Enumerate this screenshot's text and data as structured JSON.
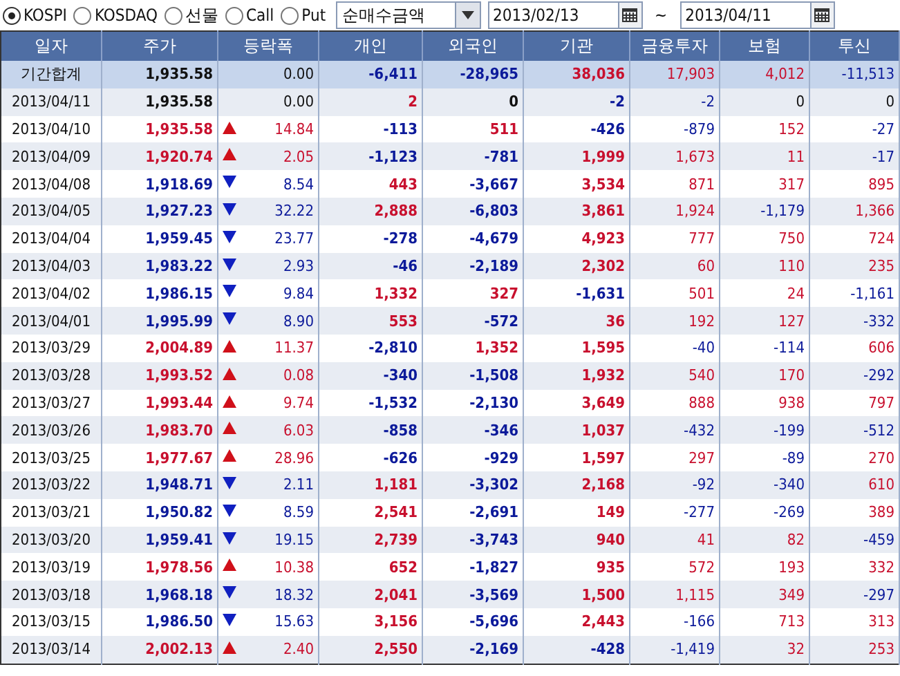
{
  "market_options": [
    {
      "label": "KOSPI",
      "selected": true
    },
    {
      "label": "KOSDAQ",
      "selected": false
    },
    {
      "label": "선물",
      "selected": false
    },
    {
      "label": "Call",
      "selected": false
    },
    {
      "label": "Put",
      "selected": false
    }
  ],
  "value_dropdown": {
    "value": "순매수금액"
  },
  "date_from": {
    "value": "2013/02/13"
  },
  "range_separator": "~",
  "date_to": {
    "value": "2013/04/11"
  },
  "table": {
    "columns": [
      "일자",
      "주가",
      "등락폭",
      "개인",
      "외국인",
      "기관",
      "금융투자",
      "보험",
      "투신"
    ],
    "total": {
      "label": "기간합계",
      "price": "1,935.58",
      "change": "0.00",
      "individual": "-6,411",
      "foreign": "-28,965",
      "institution": "38,036",
      "financial_investment": "17,903",
      "insurance": "4,012",
      "investment_trust": "-11,513"
    },
    "rows": [
      {
        "date": "2013/04/11",
        "price": "1,935.58",
        "kind": "flat",
        "change": "0.00",
        "individual": "2",
        "foreign": "0",
        "institution": "-2",
        "financial_investment": "-2",
        "insurance": "0",
        "investment_trust": "0"
      },
      {
        "date": "2013/04/10",
        "price": "1,935.58",
        "kind": "up",
        "change": "14.84",
        "individual": "-113",
        "foreign": "511",
        "institution": "-426",
        "financial_investment": "-879",
        "insurance": "152",
        "investment_trust": "-27"
      },
      {
        "date": "2013/04/09",
        "price": "1,920.74",
        "kind": "up",
        "change": "2.05",
        "individual": "-1,123",
        "foreign": "-781",
        "institution": "1,999",
        "financial_investment": "1,673",
        "insurance": "11",
        "investment_trust": "-17"
      },
      {
        "date": "2013/04/08",
        "price": "1,918.69",
        "kind": "down",
        "change": "8.54",
        "individual": "443",
        "foreign": "-3,667",
        "institution": "3,534",
        "financial_investment": "871",
        "insurance": "317",
        "investment_trust": "895"
      },
      {
        "date": "2013/04/05",
        "price": "1,927.23",
        "kind": "down",
        "change": "32.22",
        "individual": "2,888",
        "foreign": "-6,803",
        "institution": "3,861",
        "financial_investment": "1,924",
        "insurance": "-1,179",
        "investment_trust": "1,366"
      },
      {
        "date": "2013/04/04",
        "price": "1,959.45",
        "kind": "down",
        "change": "23.77",
        "individual": "-278",
        "foreign": "-4,679",
        "institution": "4,923",
        "financial_investment": "777",
        "insurance": "750",
        "investment_trust": "724"
      },
      {
        "date": "2013/04/03",
        "price": "1,983.22",
        "kind": "down",
        "change": "2.93",
        "individual": "-46",
        "foreign": "-2,189",
        "institution": "2,302",
        "financial_investment": "60",
        "insurance": "110",
        "investment_trust": "235"
      },
      {
        "date": "2013/04/02",
        "price": "1,986.15",
        "kind": "down",
        "change": "9.84",
        "individual": "1,332",
        "foreign": "327",
        "institution": "-1,631",
        "financial_investment": "501",
        "insurance": "24",
        "investment_trust": "-1,161"
      },
      {
        "date": "2013/04/01",
        "price": "1,995.99",
        "kind": "down",
        "change": "8.90",
        "individual": "553",
        "foreign": "-572",
        "institution": "36",
        "financial_investment": "192",
        "insurance": "127",
        "investment_trust": "-332"
      },
      {
        "date": "2013/03/29",
        "price": "2,004.89",
        "kind": "up",
        "change": "11.37",
        "individual": "-2,810",
        "foreign": "1,352",
        "institution": "1,595",
        "financial_investment": "-40",
        "insurance": "-114",
        "investment_trust": "606"
      },
      {
        "date": "2013/03/28",
        "price": "1,993.52",
        "kind": "up",
        "change": "0.08",
        "individual": "-340",
        "foreign": "-1,508",
        "institution": "1,932",
        "financial_investment": "540",
        "insurance": "170",
        "investment_trust": "-292"
      },
      {
        "date": "2013/03/27",
        "price": "1,993.44",
        "kind": "up",
        "change": "9.74",
        "individual": "-1,532",
        "foreign": "-2,130",
        "institution": "3,649",
        "financial_investment": "888",
        "insurance": "938",
        "investment_trust": "797"
      },
      {
        "date": "2013/03/26",
        "price": "1,983.70",
        "kind": "up",
        "change": "6.03",
        "individual": "-858",
        "foreign": "-346",
        "institution": "1,037",
        "financial_investment": "-432",
        "insurance": "-199",
        "investment_trust": "-512"
      },
      {
        "date": "2013/03/25",
        "price": "1,977.67",
        "kind": "up",
        "change": "28.96",
        "individual": "-626",
        "foreign": "-929",
        "institution": "1,597",
        "financial_investment": "297",
        "insurance": "-89",
        "investment_trust": "270"
      },
      {
        "date": "2013/03/22",
        "price": "1,948.71",
        "kind": "down",
        "change": "2.11",
        "individual": "1,181",
        "foreign": "-3,302",
        "institution": "2,168",
        "financial_investment": "-92",
        "insurance": "-340",
        "investment_trust": "610"
      },
      {
        "date": "2013/03/21",
        "price": "1,950.82",
        "kind": "down",
        "change": "8.59",
        "individual": "2,541",
        "foreign": "-2,691",
        "institution": "149",
        "financial_investment": "-277",
        "insurance": "-269",
        "investment_trust": "389"
      },
      {
        "date": "2013/03/20",
        "price": "1,959.41",
        "kind": "down",
        "change": "19.15",
        "individual": "2,739",
        "foreign": "-3,743",
        "institution": "940",
        "financial_investment": "41",
        "insurance": "82",
        "investment_trust": "-459"
      },
      {
        "date": "2013/03/19",
        "price": "1,978.56",
        "kind": "up",
        "change": "10.38",
        "individual": "652",
        "foreign": "-1,827",
        "institution": "935",
        "financial_investment": "572",
        "insurance": "193",
        "investment_trust": "332"
      },
      {
        "date": "2013/03/18",
        "price": "1,968.18",
        "kind": "down",
        "change": "18.32",
        "individual": "2,041",
        "foreign": "-3,569",
        "institution": "1,500",
        "financial_investment": "1,115",
        "insurance": "349",
        "investment_trust": "-297"
      },
      {
        "date": "2013/03/15",
        "price": "1,986.50",
        "kind": "down",
        "change": "15.63",
        "individual": "3,156",
        "foreign": "-5,696",
        "institution": "2,443",
        "financial_investment": "-166",
        "insurance": "713",
        "investment_trust": "313"
      },
      {
        "date": "2013/03/14",
        "price": "2,002.13",
        "kind": "up",
        "change": "2.40",
        "individual": "2,550",
        "foreign": "-2,169",
        "institution": "-428",
        "financial_investment": "-1,419",
        "insurance": "32",
        "investment_trust": "253"
      }
    ]
  }
}
